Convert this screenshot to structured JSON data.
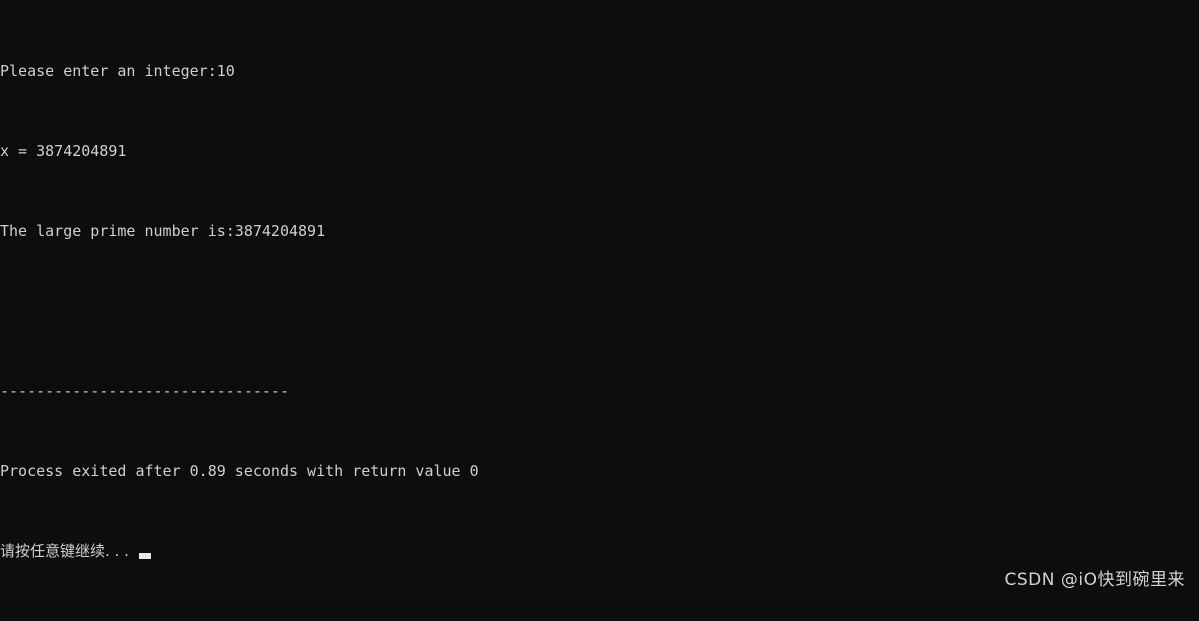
{
  "window": {
    "kind": "console-window",
    "background_color": "#0d0d0d",
    "text_color": "#cfcfcf"
  },
  "console": {
    "lines": [
      {
        "id": "prompt-input",
        "text": "Please enter an integer:10"
      },
      {
        "id": "x-value",
        "text": "x = 3874204891"
      },
      {
        "id": "result",
        "text": "The large prime number is:3874204891"
      },
      {
        "id": "blank",
        "text": ""
      },
      {
        "id": "separator",
        "text": "--------------------------------"
      },
      {
        "id": "exit-status",
        "text": "Process exited after 0.89 seconds with return value 0"
      }
    ],
    "prompt": {
      "text": "请按任意键继续. . .",
      "cursor": "block-cursor"
    }
  },
  "values": {
    "input_integer": "10",
    "x": "3874204891",
    "large_prime_number": "3874204891",
    "elapsed_seconds": "0.89",
    "return_value": "0"
  },
  "watermark": {
    "text": "CSDN @iO快到碗里来",
    "color": "#d2d2d2"
  }
}
